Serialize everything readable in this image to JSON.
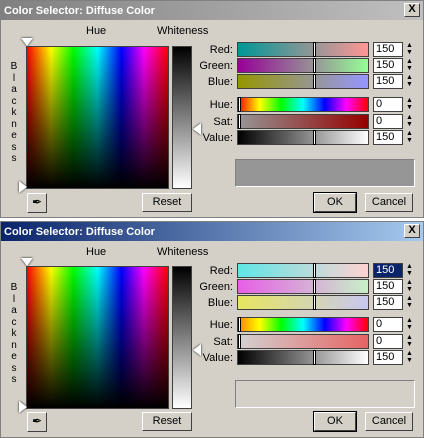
{
  "dialogs": [
    {
      "title": "Color Selector: Diffuse Color",
      "close": "X",
      "hue_label": "Hue",
      "whiteness_label": "Whiteness",
      "blackness_letters": [
        "B",
        "l",
        "a",
        "c",
        "k",
        "n",
        "e",
        "s",
        "s"
      ],
      "rows": [
        {
          "label": "Red:",
          "value": "150"
        },
        {
          "label": "Green:",
          "value": "150"
        },
        {
          "label": "Blue:",
          "value": "150"
        },
        {
          "label": "Hue:",
          "value": "0"
        },
        {
          "label": "Sat:",
          "value": "0"
        },
        {
          "label": "Value:",
          "value": "150"
        }
      ],
      "reset": "Reset",
      "ok": "OK",
      "cancel": "Cancel",
      "preview_color": "#969696",
      "title_active": false
    },
    {
      "title": "Color Selector: Diffuse Color",
      "close": "X",
      "hue_label": "Hue",
      "whiteness_label": "Whiteness",
      "blackness_letters": [
        "B",
        "l",
        "a",
        "c",
        "k",
        "n",
        "e",
        "s",
        "s"
      ],
      "rows": [
        {
          "label": "Red:",
          "value": "150"
        },
        {
          "label": "Green:",
          "value": "150"
        },
        {
          "label": "Blue:",
          "value": "150"
        },
        {
          "label": "Hue:",
          "value": "0"
        },
        {
          "label": "Sat:",
          "value": "0"
        },
        {
          "label": "Value:",
          "value": "150"
        }
      ],
      "reset": "Reset",
      "ok": "OK",
      "cancel": "Cancel",
      "preview_color": "#d4d0c8",
      "title_active": true
    }
  ]
}
